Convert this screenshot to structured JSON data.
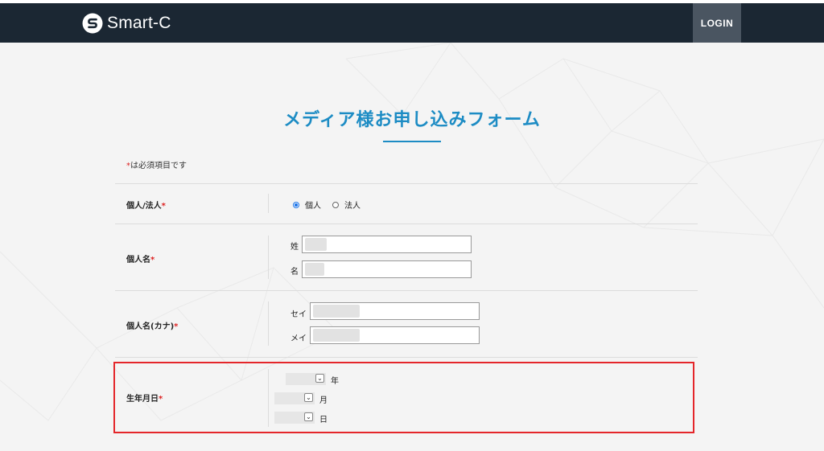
{
  "header": {
    "brand": "Smart-C",
    "login_label": "LOGIN"
  },
  "form": {
    "title": "メディア様お申し込みフォーム",
    "required_mark": "*",
    "required_note": "は必須項目です",
    "rows": [
      {
        "label": "個人/法人",
        "required": "*",
        "options": [
          {
            "label": "個人",
            "checked": true
          },
          {
            "label": "法人",
            "checked": false
          }
        ]
      },
      {
        "label": "個人名",
        "required": "*",
        "fields": [
          {
            "label": "姓",
            "value": ""
          },
          {
            "label": "名",
            "value": ""
          }
        ]
      },
      {
        "label": "個人名(カナ)",
        "required": "*",
        "fields": [
          {
            "label": "セイ",
            "value": ""
          },
          {
            "label": "メイ",
            "value": ""
          }
        ]
      },
      {
        "label": "生年月日",
        "required": "*",
        "selects": [
          {
            "unit": "年",
            "value": ""
          },
          {
            "unit": "月",
            "value": ""
          },
          {
            "unit": "日",
            "value": ""
          }
        ]
      }
    ]
  },
  "colors": {
    "navbar": "#1b2733",
    "accent": "#1d8cc4",
    "required": "#dd2222",
    "highlight": "#e4262a"
  },
  "icons": {
    "brand": "smart-c-logo-icon",
    "select": "chevron-down-icon"
  }
}
